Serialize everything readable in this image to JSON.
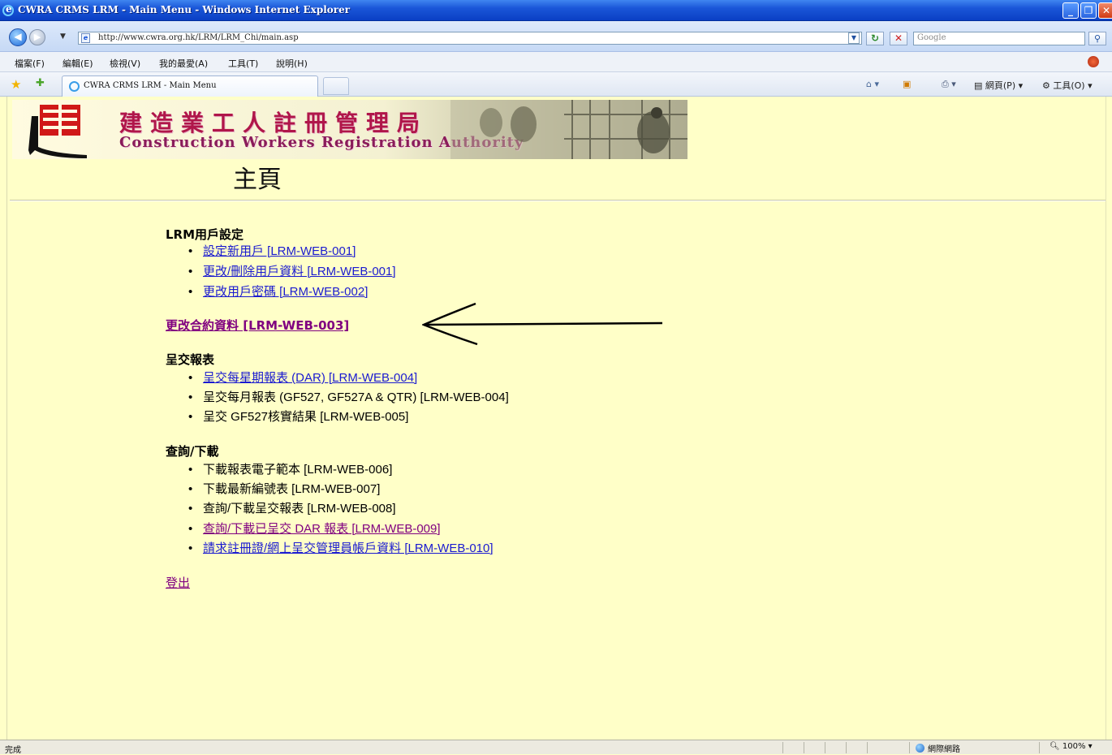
{
  "window": {
    "title": "CWRA CRMS LRM - Main Menu - Windows Internet Explorer"
  },
  "address_bar": {
    "url": "http://www.cwra.org.hk/LRM/LRM_Chi/main.asp",
    "search_placeholder": "Google"
  },
  "menu": [
    "檔案(F)",
    "編輯(E)",
    "檢視(V)",
    "我的最愛(A)",
    "工具(T)",
    "說明(H)"
  ],
  "tab": {
    "label": "CWRA CRMS LRM - Main Menu"
  },
  "command_bar": {
    "page_label": "網頁(P)",
    "tools_label": "工具(O)"
  },
  "banner": {
    "title_zh": "建造業工人註冊管理局",
    "title_en": "Construction Workers Registration Authority"
  },
  "page_title": "主頁",
  "sections": {
    "user_settings": {
      "title": "LRM用戶設定",
      "items": [
        {
          "label": "設定新用戶 [LRM-WEB-001]",
          "link": true
        },
        {
          "label": "更改/刪除用戶資料 [LRM-WEB-001]",
          "link": true
        },
        {
          "label": "更改用戶密碼 [LRM-WEB-002]",
          "link": true
        }
      ]
    },
    "contract_link": "更改合約資料 [LRM-WEB-003]",
    "submit_reports": {
      "title": "呈交報表",
      "items": [
        {
          "label": "呈交每星期報表 (DAR) [LRM-WEB-004]",
          "link": true
        },
        {
          "label": "呈交每月報表 (GF527, GF527A & QTR) [LRM-WEB-004]",
          "link": false
        },
        {
          "label": "呈交 GF527核實結果 [LRM-WEB-005]",
          "link": false
        }
      ]
    },
    "query_download": {
      "title": "查詢/下載",
      "items": [
        {
          "label": "下載報表電子範本 [LRM-WEB-006]",
          "link": false
        },
        {
          "label": "下載最新編號表 [LRM-WEB-007]",
          "link": false
        },
        {
          "label": "查詢/下載呈交報表 [LRM-WEB-008]",
          "link": false
        },
        {
          "label": "查詢/下載已呈交 DAR 報表 [LRM-WEB-009]",
          "link": true,
          "visited": true
        },
        {
          "label": "請求註冊證/網上呈交管理員帳戶資料 [LRM-WEB-010]",
          "link": true
        }
      ]
    },
    "logout": "登出"
  },
  "status_bar": {
    "status": "完成",
    "zone": "網際網路",
    "zoom": "100%"
  },
  "colors": {
    "page_background": "#ffffc8",
    "link": "#1a1ad0",
    "visited_link": "#800080",
    "banner_text": "#b0164a"
  }
}
